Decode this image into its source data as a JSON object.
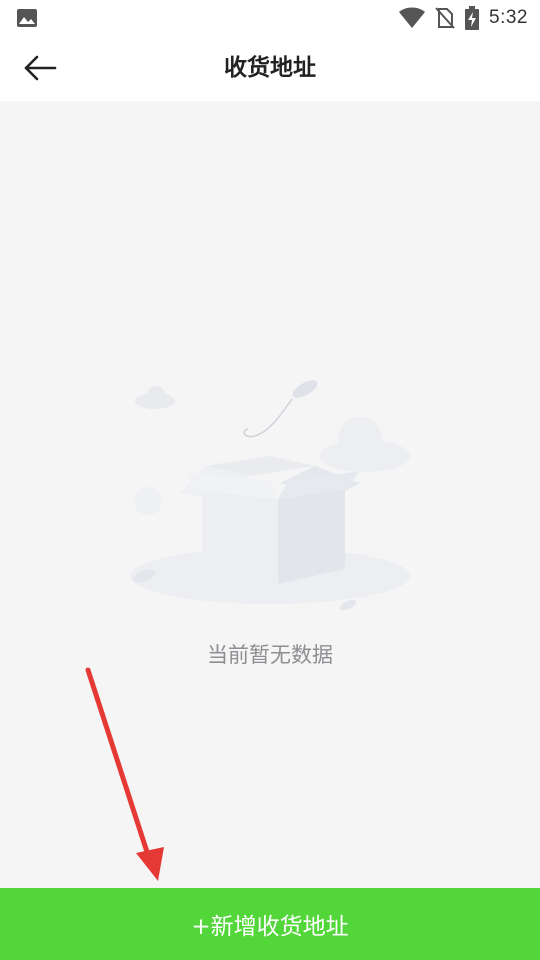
{
  "status_bar": {
    "time": "5:32",
    "icons": [
      "image-icon",
      "wifi-icon",
      "no-sim-icon",
      "battery-charging-icon"
    ]
  },
  "app_bar": {
    "title": "收货地址",
    "back_icon": "arrow-left-icon"
  },
  "empty_state": {
    "message": "当前暂无数据",
    "illustration": "empty-box-illustration"
  },
  "actions": {
    "add_address_label": "+新增收货地址"
  },
  "colors": {
    "primary_green": "#52d639",
    "background": "#f5f5f5",
    "annotation_red": "#e53935"
  }
}
